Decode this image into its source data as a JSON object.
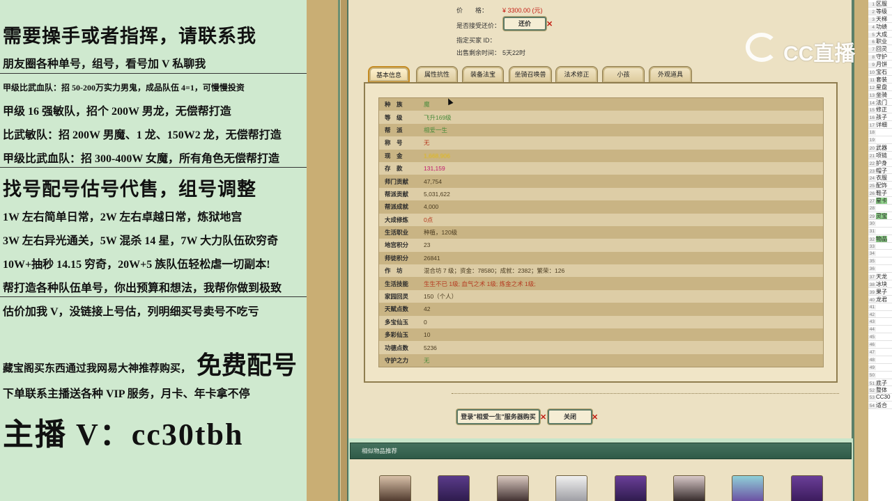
{
  "promo": {
    "l1": "需要操手或者指挥，请联系我",
    "l2": "朋友圈各种单号，组号，看号加 V 私聊我",
    "l3": "甲级比武血队：招 50-200万实力男鬼，成品队伍 4=1，可慢慢投资",
    "l4": "甲级 16 强敏队，招个 200W 男龙，无偿帮打造",
    "l5": "比武敏队：招 200W 男魔、1 龙、150W2 龙，无偿帮打造",
    "l6": "甲级比武血队：招 300-400W 女魔，所有角色无偿帮打造",
    "l7": "找号配号估号代售，组号调整",
    "l8": "1W 左右简单日常，2W 左右卓越日常，炼狱地宫",
    "l9": "3W 左右异光通关，5W 混杀 14 星，7W 大力队伍砍穷奇",
    "l10": "10W+抽秒 14.15 穷奇，20W+5 族队伍轻松虐一切副本!",
    "l11": "帮打造各种队伍单号，你出预算和想法，我帮你做到极致",
    "l12": "估价加我 V，没链接上号估，列明细买号卖号不吃亏",
    "l13": "藏宝阁买东西通过我网易大神推荐购买，",
    "l13b": "免费配号",
    "l14": "下单联系主播送各种 VIP 服务，月卡、年卡拿不停",
    "l15": "主播 V：cc30tbh"
  },
  "listing": {
    "price_label": "价　　格：",
    "price_value": "¥ 3300.00 (元)",
    "counter_label": "是否接受还价：",
    "counter_button": "还价",
    "buyer_label": "指定买家 ID：",
    "remaining_label": "出售剩余时间：",
    "remaining_value": "5天22时"
  },
  "tabs": [
    "基本信息",
    "属性抗性",
    "装备法宝",
    "坐骑召唤兽",
    "法术修正",
    "小孩",
    "外观道具"
  ],
  "attributes": [
    {
      "k": "种　族",
      "v": "魔",
      "style": "green"
    },
    {
      "k": "等　级",
      "v": "飞升169级",
      "style": "green"
    },
    {
      "k": "帮　派",
      "v": "相爱一生",
      "style": "green"
    },
    {
      "k": "称　号",
      "v": "无",
      "style": "red"
    },
    {
      "k": "现　金",
      "v": "1,668,906",
      "style": "gold"
    },
    {
      "k": "存　款",
      "v": "131,159",
      "style": "pink"
    },
    {
      "k": "师门贡献",
      "v": "47,754",
      "style": ""
    },
    {
      "k": "帮派贡献",
      "v": "5,031,622",
      "style": ""
    },
    {
      "k": "帮派成就",
      "v": "4,000",
      "style": ""
    },
    {
      "k": "大成修炼",
      "v": "0点",
      "style": "red"
    },
    {
      "k": "生活职业",
      "v": "种植，120级",
      "style": ""
    },
    {
      "k": "地宫积分",
      "v": "23",
      "style": ""
    },
    {
      "k": "师徒积分",
      "v": "26841",
      "style": ""
    },
    {
      "k": "作　坊",
      "v": "混合坊 7 级；资金：78580；成就：2382；繁荣：126",
      "style": ""
    },
    {
      "k": "生活技能",
      "v": "生生不已 1级; 血气之术 1级; 炼金之术 1级;",
      "style": "red"
    },
    {
      "k": "家园回灵",
      "v": "150（个人）",
      "style": ""
    },
    {
      "k": "天赋点数",
      "v": "42",
      "style": ""
    },
    {
      "k": "多宝仙玉",
      "v": "0",
      "style": ""
    },
    {
      "k": "多彩仙玉",
      "v": "10",
      "style": ""
    },
    {
      "k": "功德点数",
      "v": "5236",
      "style": ""
    },
    {
      "k": "守护之力",
      "v": "无",
      "style": "green"
    }
  ],
  "buttons": {
    "login": "登录\"相爱一生\"服务器购买",
    "close": "关闭"
  },
  "similar": {
    "title": "相似物品推荐"
  },
  "watermark": {
    "text": "CC直播"
  },
  "sheet_rows": [
    {
      "n": "1",
      "c": "区服"
    },
    {
      "n": "2",
      "c": "等级"
    },
    {
      "n": "3",
      "c": "天梯"
    },
    {
      "n": "4",
      "c": "功绩"
    },
    {
      "n": "5",
      "c": "大成"
    },
    {
      "n": "6",
      "c": "职业"
    },
    {
      "n": "7",
      "c": "回灵"
    },
    {
      "n": "8",
      "c": "守护"
    },
    {
      "n": "9",
      "c": "月饼"
    },
    {
      "n": "10",
      "c": "宝石"
    },
    {
      "n": "11",
      "c": "套装"
    },
    {
      "n": "12",
      "c": "星盘"
    },
    {
      "n": "13",
      "c": "坐骑"
    },
    {
      "n": "14",
      "c": "法门"
    },
    {
      "n": "15",
      "c": "修正"
    },
    {
      "n": "16",
      "c": "孩子"
    },
    {
      "n": "17",
      "c": "详细"
    },
    {
      "n": "18",
      "c": ""
    },
    {
      "n": "19",
      "c": ""
    },
    {
      "n": "20",
      "c": "武器"
    },
    {
      "n": "21",
      "c": "项链"
    },
    {
      "n": "22",
      "c": "护身"
    },
    {
      "n": "23",
      "c": "帽子"
    },
    {
      "n": "24",
      "c": "衣服"
    },
    {
      "n": "25",
      "c": "配饰"
    },
    {
      "n": "26",
      "c": "鞋子"
    },
    {
      "n": "27",
      "c": "星卡"
    },
    {
      "n": "28",
      "c": ""
    },
    {
      "n": "29",
      "c": "灵宝"
    },
    {
      "n": "30",
      "c": ""
    },
    {
      "n": "31",
      "c": ""
    },
    {
      "n": "32",
      "c": "物品"
    },
    {
      "n": "33",
      "c": ""
    },
    {
      "n": "34",
      "c": ""
    },
    {
      "n": "35",
      "c": ""
    },
    {
      "n": "36",
      "c": ""
    },
    {
      "n": "37",
      "c": "天龙"
    },
    {
      "n": "38",
      "c": "冰块"
    },
    {
      "n": "39",
      "c": "果子"
    },
    {
      "n": "40",
      "c": "龙君"
    },
    {
      "n": "41",
      "c": ""
    },
    {
      "n": "42",
      "c": ""
    },
    {
      "n": "43",
      "c": ""
    },
    {
      "n": "44",
      "c": ""
    },
    {
      "n": "45",
      "c": ""
    },
    {
      "n": "46",
      "c": ""
    },
    {
      "n": "47",
      "c": ""
    },
    {
      "n": "48",
      "c": ""
    },
    {
      "n": "49",
      "c": ""
    },
    {
      "n": "50",
      "c": ""
    },
    {
      "n": "51",
      "c": "底子"
    },
    {
      "n": "52",
      "c": "整体"
    },
    {
      "n": "53",
      "c": "CC30"
    },
    {
      "n": "54",
      "c": "适合"
    }
  ],
  "colors": {
    "panel": "#ece1c3",
    "accent_green": "#3c6a55",
    "price_red": "#c41b12"
  },
  "icons": [
    "cc-logo-icon",
    "close-x-icon",
    "cursor-icon"
  ]
}
